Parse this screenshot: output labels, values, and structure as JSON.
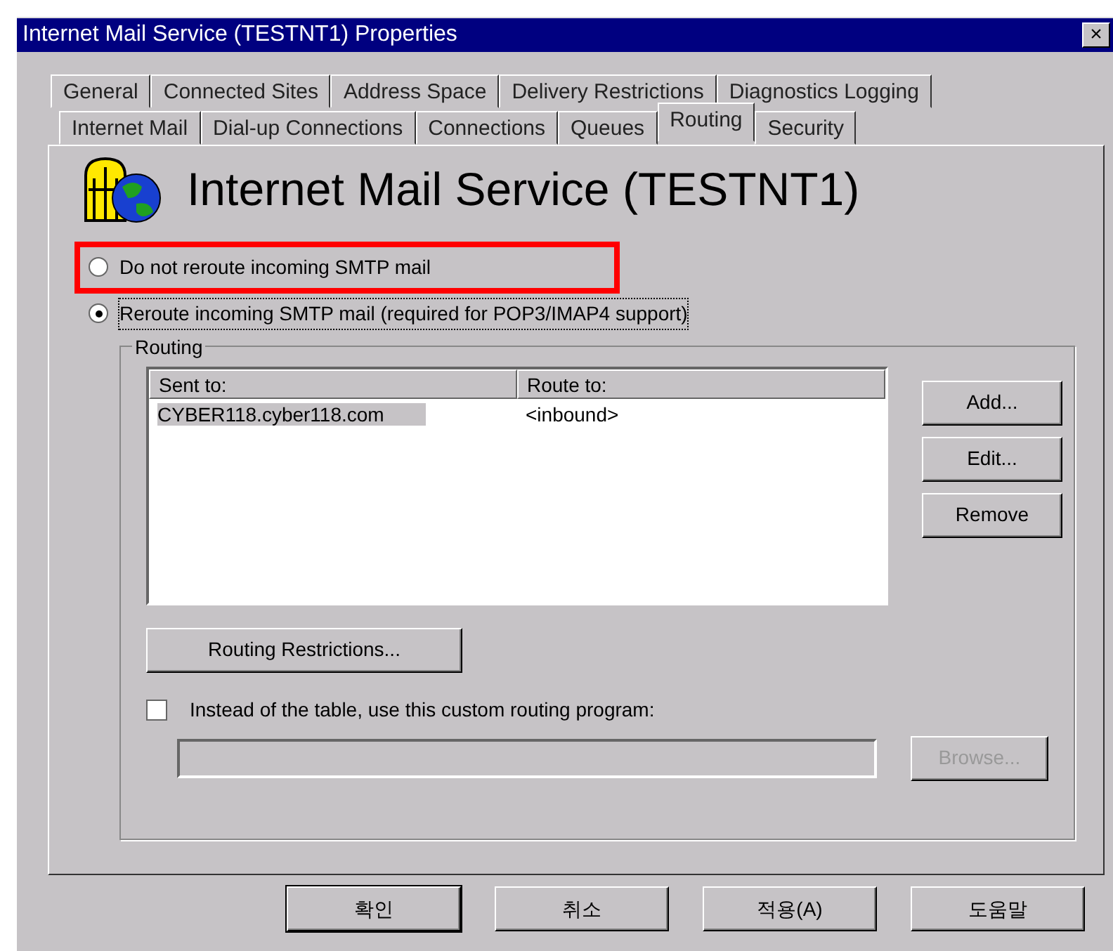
{
  "window": {
    "title": "Internet Mail Service (TESTNT1) Properties",
    "close": "×"
  },
  "tab_rows": [
    [
      {
        "label": "General",
        "selected": false
      },
      {
        "label": "Connected Sites",
        "selected": false
      },
      {
        "label": "Address Space",
        "selected": false
      },
      {
        "label": "Delivery Restrictions",
        "selected": false
      },
      {
        "label": "Diagnostics Logging",
        "selected": false
      }
    ],
    [
      {
        "label": "Internet Mail",
        "selected": false
      },
      {
        "label": "Dial-up Connections",
        "selected": false
      },
      {
        "label": "Connections",
        "selected": false
      },
      {
        "label": "Queues",
        "selected": false
      },
      {
        "label": "Routing",
        "selected": true
      },
      {
        "label": "Security",
        "selected": false
      }
    ]
  ],
  "heading": "Internet Mail Service (TESTNT1)",
  "options": [
    {
      "label": "Do not reroute incoming SMTP mail",
      "selected": false,
      "highlighted": true
    },
    {
      "label": "Reroute incoming SMTP mail (required for POP3/IMAP4 support)",
      "selected": true,
      "highlighted": false
    }
  ],
  "routing": {
    "title": "Routing",
    "columns": [
      "Sent to:",
      "Route to:"
    ],
    "rows": [
      {
        "cells": [
          "CYBER118.cyber118.com",
          "<inbound>"
        ],
        "selected": true
      }
    ],
    "buttons": [
      {
        "label": "Add...",
        "disabled": false
      },
      {
        "label": "Edit...",
        "disabled": false
      },
      {
        "label": "Remove",
        "disabled": false
      }
    ],
    "restrictions_button": "Routing Restrictions...",
    "custom": {
      "label": "Instead of the table, use this custom routing program:",
      "checked": false
    },
    "browse": {
      "label": "Browse...",
      "disabled": true
    }
  },
  "footer_buttons": [
    {
      "label": "확인",
      "default": true
    },
    {
      "label": "취소",
      "default": false
    },
    {
      "label": "적용(A)",
      "default": false
    },
    {
      "label": "도움말",
      "default": false
    }
  ]
}
